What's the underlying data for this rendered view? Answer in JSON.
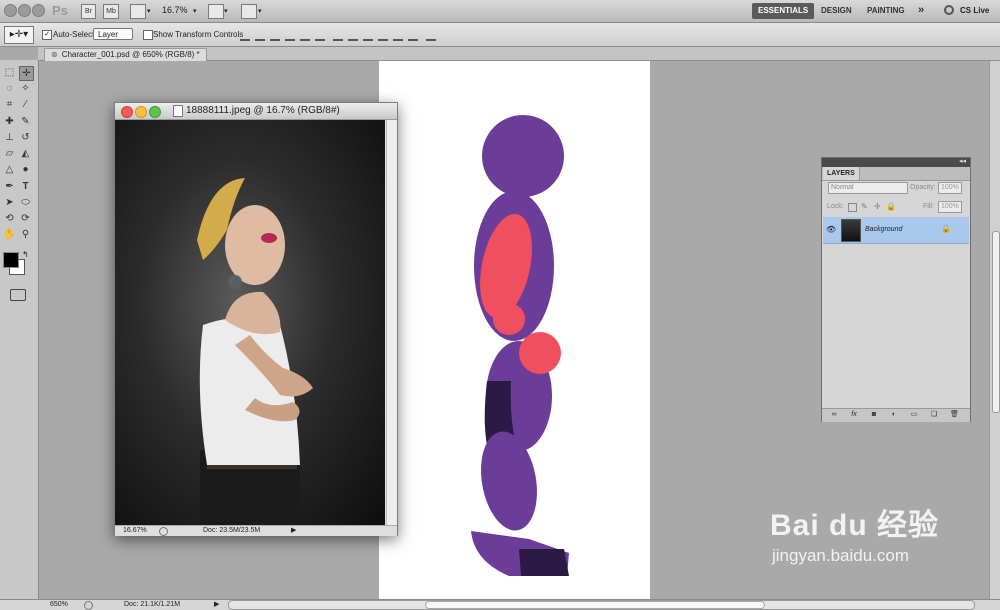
{
  "app": {
    "logo": "Ps",
    "appbar_buttons": [
      "Br",
      "Mb"
    ],
    "zoom_menu": "16.7%",
    "workspaces": [
      "ESSENTIALS",
      "DESIGN",
      "PAINTING"
    ],
    "more_chevron": "»",
    "cs_live": "CS Live"
  },
  "options_bar": {
    "auto_select_label": "Auto-Select:",
    "auto_select_value": "Layer",
    "show_transform_label": "Show Transform Controls"
  },
  "doc_tab": {
    "title": "Character_001.psd @ 650% (RGB/8) *"
  },
  "photo_window": {
    "title": "18888111.jpeg @ 16.7% (RGB/8#)",
    "zoom": "16.67%",
    "doc_info": "Doc: 23.5M/23.5M"
  },
  "status_bar": {
    "zoom": "650%",
    "doc_info": "Doc: 21.1K/1.21M"
  },
  "layers_panel": {
    "tab": "LAYERS",
    "blend_mode": "Normal",
    "opacity_label": "Opacity:",
    "opacity_value": "100%",
    "lock_label": "Lock:",
    "fill_label": "Fill:",
    "fill_value": "100%",
    "layer_name": "Background"
  },
  "watermark": {
    "text": "Bai du 经验",
    "url": "jingyan.baidu.com"
  },
  "colors": {
    "figure_purple": "#6b3d98",
    "figure_dark": "#2a1a45",
    "figure_red": "#ef4f5e",
    "accent_selected": "#a9c8ec"
  }
}
